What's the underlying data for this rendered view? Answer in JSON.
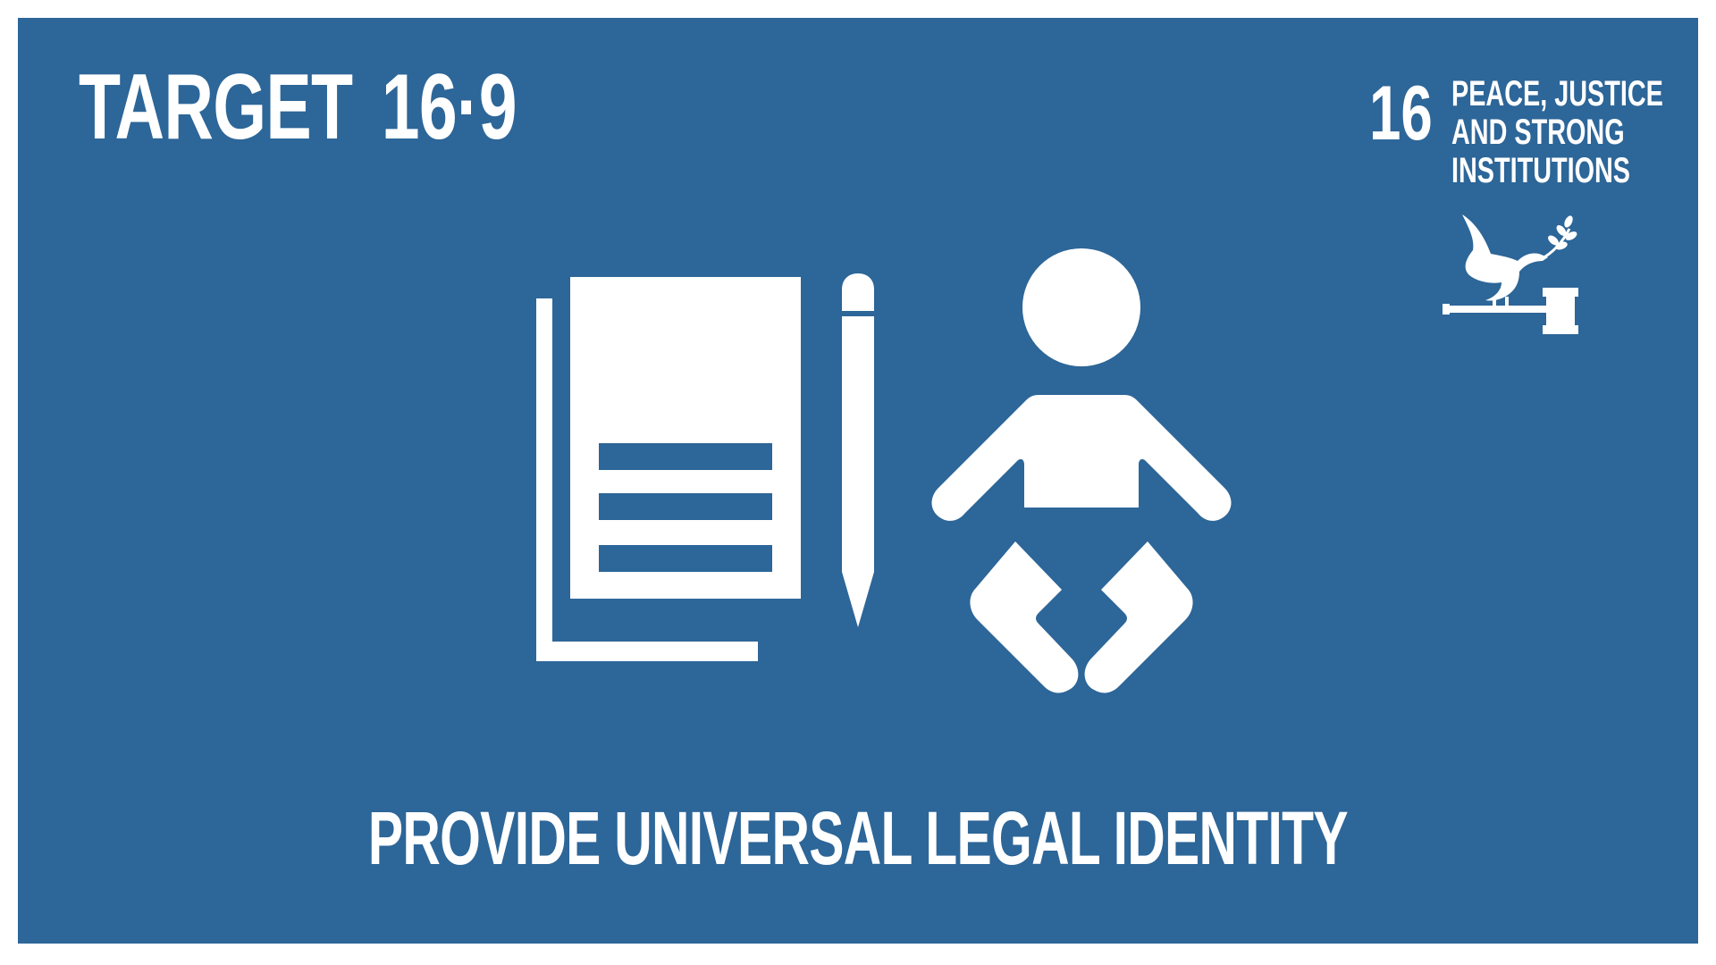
{
  "target": {
    "label": "TARGET",
    "number": "16·9"
  },
  "goal": {
    "number": "16",
    "title_lines": [
      "PEACE, JUSTICE",
      "AND STRONG",
      "INSTITUTIONS"
    ],
    "emblem_icon": "dove-gavel-icon"
  },
  "illustration": {
    "icons": [
      "document-icon",
      "pencil-icon",
      "baby-icon"
    ]
  },
  "caption": "PROVIDE UNIVERSAL LEGAL IDENTITY",
  "colors": {
    "background": "#2d6698",
    "foreground": "#ffffff",
    "frame": "#ffffff"
  }
}
